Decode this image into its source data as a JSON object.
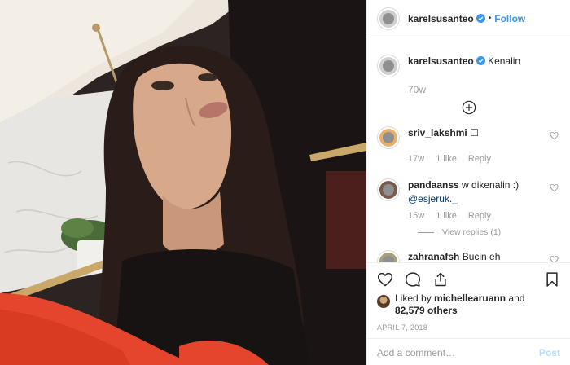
{
  "post": {
    "author": "karelsusanteo",
    "follow_label": "Follow",
    "separator": "•",
    "photo_alt_icon": "photo-image"
  },
  "caption": {
    "author": "karelsusanteo",
    "text": "Kenalin",
    "time": "70w"
  },
  "comments": [
    {
      "author": "sriv_lakshmi",
      "text": "☐",
      "time": "17w",
      "likes": "1 like",
      "reply": "Reply"
    },
    {
      "author": "pandaanss",
      "text": "w dikenalin :)",
      "mention": "@esjeruk._",
      "time": "15w",
      "likes": "1 like",
      "reply": "Reply",
      "view_replies": "View replies (1)"
    },
    {
      "author": "zahranafsh",
      "text": "Bucin eh"
    }
  ],
  "likes": {
    "prefix": "Liked by ",
    "user": "michellearuann",
    "mid": " and",
    "count": "82,579 others"
  },
  "date": "APRIL 7, 2018",
  "add_comment": {
    "placeholder": "Add a comment…",
    "post_label": "Post"
  },
  "colors": {
    "accent": "#3897f0",
    "muted": "#999999",
    "verified": "#3897f0"
  }
}
